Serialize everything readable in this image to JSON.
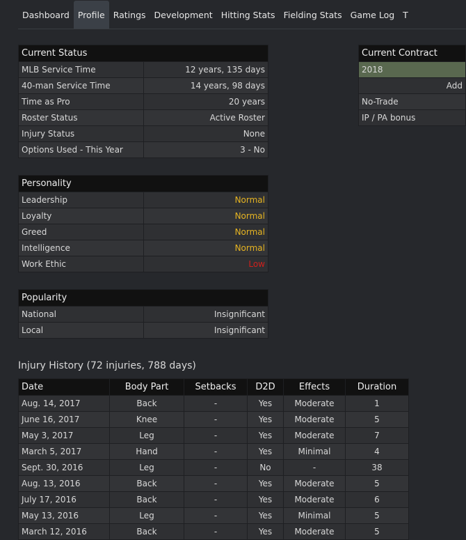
{
  "tabs": [
    "Dashboard",
    "Profile",
    "Ratings",
    "Development",
    "Hitting Stats",
    "Fielding Stats",
    "Game Log",
    "T"
  ],
  "active_tab": "Profile",
  "current_status": {
    "title": "Current Status",
    "rows": [
      [
        "MLB Service Time",
        "12 years, 135 days"
      ],
      [
        "40-man Service Time",
        "14 years, 98 days"
      ],
      [
        "Time as Pro",
        "20 years"
      ],
      [
        "Roster Status",
        "Active Roster"
      ],
      [
        "Injury Status",
        "None"
      ],
      [
        "Options Used - This Year",
        "3 - No"
      ]
    ]
  },
  "personality": {
    "title": "Personality",
    "rows": [
      [
        "Leadership",
        "Normal"
      ],
      [
        "Loyalty",
        "Normal"
      ],
      [
        "Greed",
        "Normal"
      ],
      [
        "Intelligence",
        "Normal"
      ],
      [
        "Work Ethic",
        "Low"
      ]
    ]
  },
  "popularity": {
    "title": "Popularity",
    "rows": [
      [
        "National",
        "Insignificant"
      ],
      [
        "Local",
        "Insignificant"
      ]
    ]
  },
  "contract": {
    "title": "Current Contract",
    "year": "2018",
    "add": "Add",
    "rows": [
      "No-Trade",
      "IP / PA bonus"
    ]
  },
  "injury": {
    "title": "Injury History (72 injuries, 788 days)",
    "headers": [
      "Date",
      "Body Part",
      "Setbacks",
      "D2D",
      "Effects",
      "Duration"
    ],
    "rows": [
      [
        "Aug. 14, 2017",
        "Back",
        "-",
        "Yes",
        "Moderate",
        "1"
      ],
      [
        "June 16, 2017",
        "Knee",
        "-",
        "Yes",
        "Moderate",
        "5"
      ],
      [
        "May 3, 2017",
        "Leg",
        "-",
        "Yes",
        "Moderate",
        "7"
      ],
      [
        "March 5, 2017",
        "Hand",
        "-",
        "Yes",
        "Minimal",
        "4"
      ],
      [
        "Sept. 30, 2016",
        "Leg",
        "-",
        "No",
        "-",
        "38"
      ],
      [
        "Aug. 13, 2016",
        "Back",
        "-",
        "Yes",
        "Moderate",
        "5"
      ],
      [
        "July 17, 2016",
        "Back",
        "-",
        "Yes",
        "Moderate",
        "6"
      ],
      [
        "May 13, 2016",
        "Leg",
        "-",
        "Yes",
        "Minimal",
        "5"
      ],
      [
        "March 12, 2016",
        "Back",
        "-",
        "Yes",
        "Moderate",
        "5"
      ]
    ]
  },
  "colors": {
    "normal": "#e6b422",
    "low": "#d0201c",
    "contract_year": "#59684f"
  }
}
